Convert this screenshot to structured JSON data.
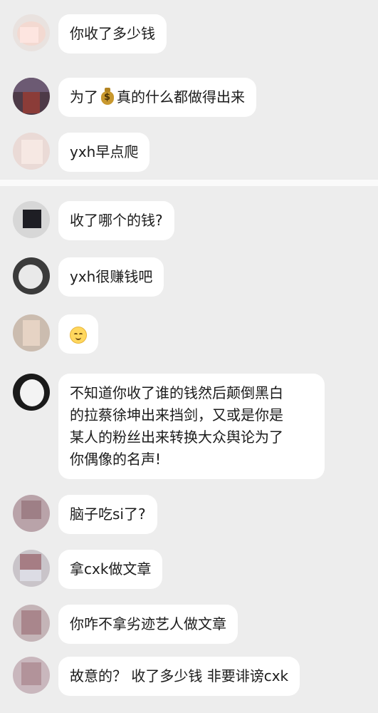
{
  "messages_top": [
    {
      "text": "你收了多少钱"
    },
    {
      "text_before": "为了",
      "icon": "money-bag-icon",
      "text_after": "真的什么都做得出来"
    },
    {
      "text": "yxh早点爬"
    }
  ],
  "messages_bottom": [
    {
      "text": "收了哪个的钱?"
    },
    {
      "text": "yxh很赚钱吧"
    },
    {
      "icon": "smiling-face-icon"
    },
    {
      "lines": [
        "不知道你收了谁的钱然后颠倒黑白",
        "的拉蔡徐坤出来挡剑，又或是你是",
        "某人的粉丝出来转换大众舆论为了",
        "你偶像的名声!"
      ]
    },
    {
      "text": "脑子吃si了?"
    },
    {
      "text": "拿cxk做文章"
    },
    {
      "text": "你咋不拿劣迹艺人做文章"
    },
    {
      "text": "故意的？ 收了多少钱 非要诽谤cxk"
    }
  ],
  "colors": {
    "background": "#ededed",
    "bubble": "#ffffff",
    "text": "#1b1b1b",
    "divider": "#fafafa"
  }
}
